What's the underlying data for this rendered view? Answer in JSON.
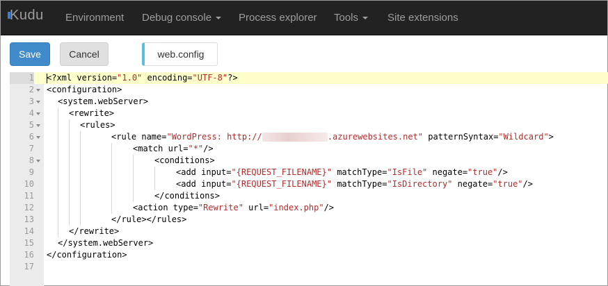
{
  "navbar": {
    "brand": "Kudu",
    "items": [
      {
        "label": "Environment"
      },
      {
        "label": "Debug console"
      },
      {
        "label": "Process explorer"
      },
      {
        "label": "Tools"
      },
      {
        "label": "Site extensions"
      }
    ]
  },
  "toolbar": {
    "save_label": "Save",
    "cancel_label": "Cancel",
    "file_tab": "web.config"
  },
  "colors": {
    "navbar_bg": "#222222",
    "save_button": "#428bca",
    "active_line": "#ffffcc",
    "string": "#b42a2a",
    "tab_accent": "#5bc0de"
  },
  "editor": {
    "active_line": 1,
    "fold_lines": [
      2,
      3,
      4,
      5,
      6,
      8
    ],
    "line_numbers": [
      "1",
      "2",
      "3",
      "4",
      "5",
      "6",
      "7",
      "8",
      "9",
      "10",
      "11",
      "12",
      "13",
      "14",
      "15",
      "16",
      "17"
    ],
    "lines": {
      "l1": {
        "a": "<?xml version=",
        "b": "\"1.0\"",
        "c": " encoding=",
        "d": "\"UTF-8\"",
        "e": "?>"
      },
      "l2": "<configuration>",
      "l3": "<system.webServer>",
      "l4": "<rewrite>",
      "l5": "<rules>",
      "l6": {
        "a": "<rule name=",
        "b": "\"WordPress: http://",
        "c": "",
        "d": ".azurewebsites.net\"",
        "e": " patternSyntax=",
        "f": "\"Wildcard\"",
        "g": ">"
      },
      "l7": {
        "a": "<match url=",
        "b": "\"*\"",
        "c": "/>"
      },
      "l8": "<conditions>",
      "l9": {
        "a": "<add input=",
        "b": "\"{REQUEST_FILENAME}\"",
        "c": " matchType=",
        "d": "\"IsFile\"",
        "e": " negate=",
        "f": "\"true\"",
        "g": "/>"
      },
      "l10": {
        "a": "<add input=",
        "b": "\"{REQUEST_FILENAME}\"",
        "c": " matchType=",
        "d": "\"IsDirectory\"",
        "e": " negate=",
        "f": "\"true\"",
        "g": "/>"
      },
      "l11": "</conditions>",
      "l12": {
        "a": "<action type=",
        "b": "\"Rewrite\"",
        "c": " url=",
        "d": "\"index.php\"",
        "e": "/>"
      },
      "l13": "</rule></rules>",
      "l14": "</rewrite>",
      "l15": "</system.webServer>",
      "l16": "</configuration>",
      "l17": ""
    }
  }
}
